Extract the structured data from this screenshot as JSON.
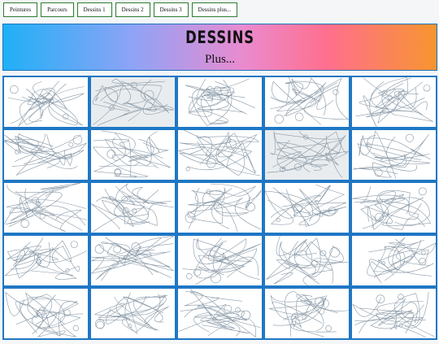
{
  "nav": {
    "items": [
      "Peintures",
      "Parcours",
      "Dessins 1",
      "Dessins 2",
      "Dessins 3",
      "Dessins plus..."
    ]
  },
  "banner": {
    "title": "DESSINS",
    "subtitle": "Plus..."
  },
  "gallery": {
    "rows": 5,
    "cols": 5,
    "line_color": "#8a9aa8",
    "accent_color": "#1f77c4",
    "thumb_icon": "pencil-sketch-thumbnail"
  }
}
